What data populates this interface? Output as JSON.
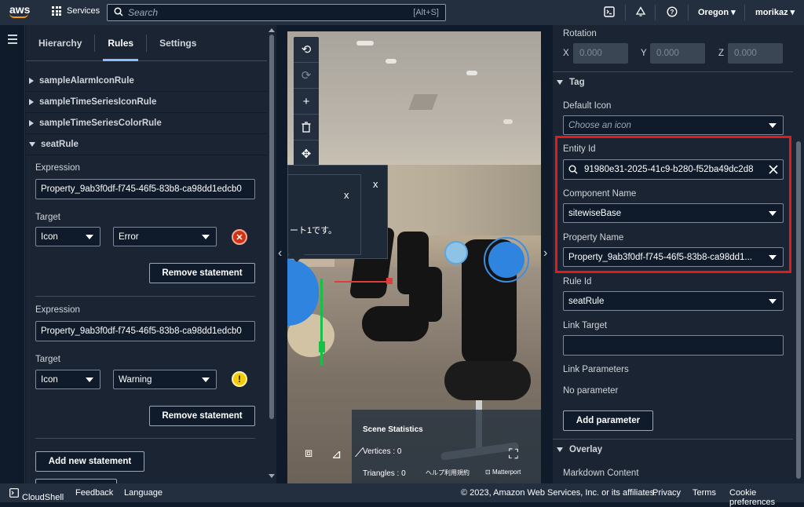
{
  "topbar": {
    "logo": "aws",
    "services": "Services",
    "search_placeholder": "Search",
    "search_hint": "[Alt+S]",
    "region": "Oregon",
    "user": "morikaz"
  },
  "left_panel": {
    "tabs": [
      "Hierarchy",
      "Rules",
      "Settings"
    ],
    "rules": [
      "sampleAlarmIconRule",
      "sampleTimeSeriesIconRule",
      "sampleTimeSeriesColorRule",
      "seatRule"
    ],
    "statements": [
      {
        "expression_label": "Expression",
        "expression": "Property_9ab3f0df-f745-46f5-83b8-ca98dd1edcb0",
        "target_label": "Target",
        "target_type": "Icon",
        "target_value": "Error",
        "remove": "Remove statement"
      },
      {
        "expression_label": "Expression",
        "expression": "Property_9ab3f0df-f745-46f5-83b8-ca98dd1edcb0",
        "target_label": "Target",
        "target_type": "Icon",
        "target_value": "Warning",
        "remove": "Remove statement"
      }
    ],
    "add_statement": "Add new statement"
  },
  "scene": {
    "popup_close": "x",
    "popup_text": "ート1です。",
    "stats_title": "Scene Statistics",
    "vertices": "Vertices : 0",
    "triangles": "Triangles : 0",
    "help": "ヘルプ",
    "terms": "利用規約",
    "matterport": "Matterport"
  },
  "right_panel": {
    "rotation_label": "Rotation",
    "x_label": "X",
    "x_value": "0.000",
    "y_label": "Y",
    "y_value": "0.000",
    "z_label": "Z",
    "z_value": "0.000",
    "tag_section": "Tag",
    "default_icon_label": "Default Icon",
    "default_icon_placeholder": "Choose an icon",
    "entity_id_label": "Entity Id",
    "entity_id_value": "91980e31-2025-41c9-b280-f52ba49dc2d8",
    "component_name_label": "Component Name",
    "component_name_value": "sitewiseBase",
    "property_name_label": "Property Name",
    "property_name_value": "Property_9ab3f0df-f745-46f5-83b8-ca98dd1...",
    "rule_id_label": "Rule Id",
    "rule_id_value": "seatRule",
    "link_target_label": "Link Target",
    "link_params_label": "Link Parameters",
    "no_parameter": "No parameter",
    "add_parameter": "Add parameter",
    "overlay_section": "Overlay",
    "markdown_label": "Markdown Content"
  },
  "footer": {
    "cloudshell": "CloudShell",
    "feedback": "Feedback",
    "language": "Language",
    "copyright": "© 2023, Amazon Web Services, Inc. or its affiliates.",
    "privacy": "Privacy",
    "terms": "Terms",
    "cookies": "Cookie preferences"
  },
  "colors": {
    "accent": "#89bdff",
    "error": "#d13212",
    "warning": "#f2cc0c",
    "highlight": "#e51b1b"
  }
}
